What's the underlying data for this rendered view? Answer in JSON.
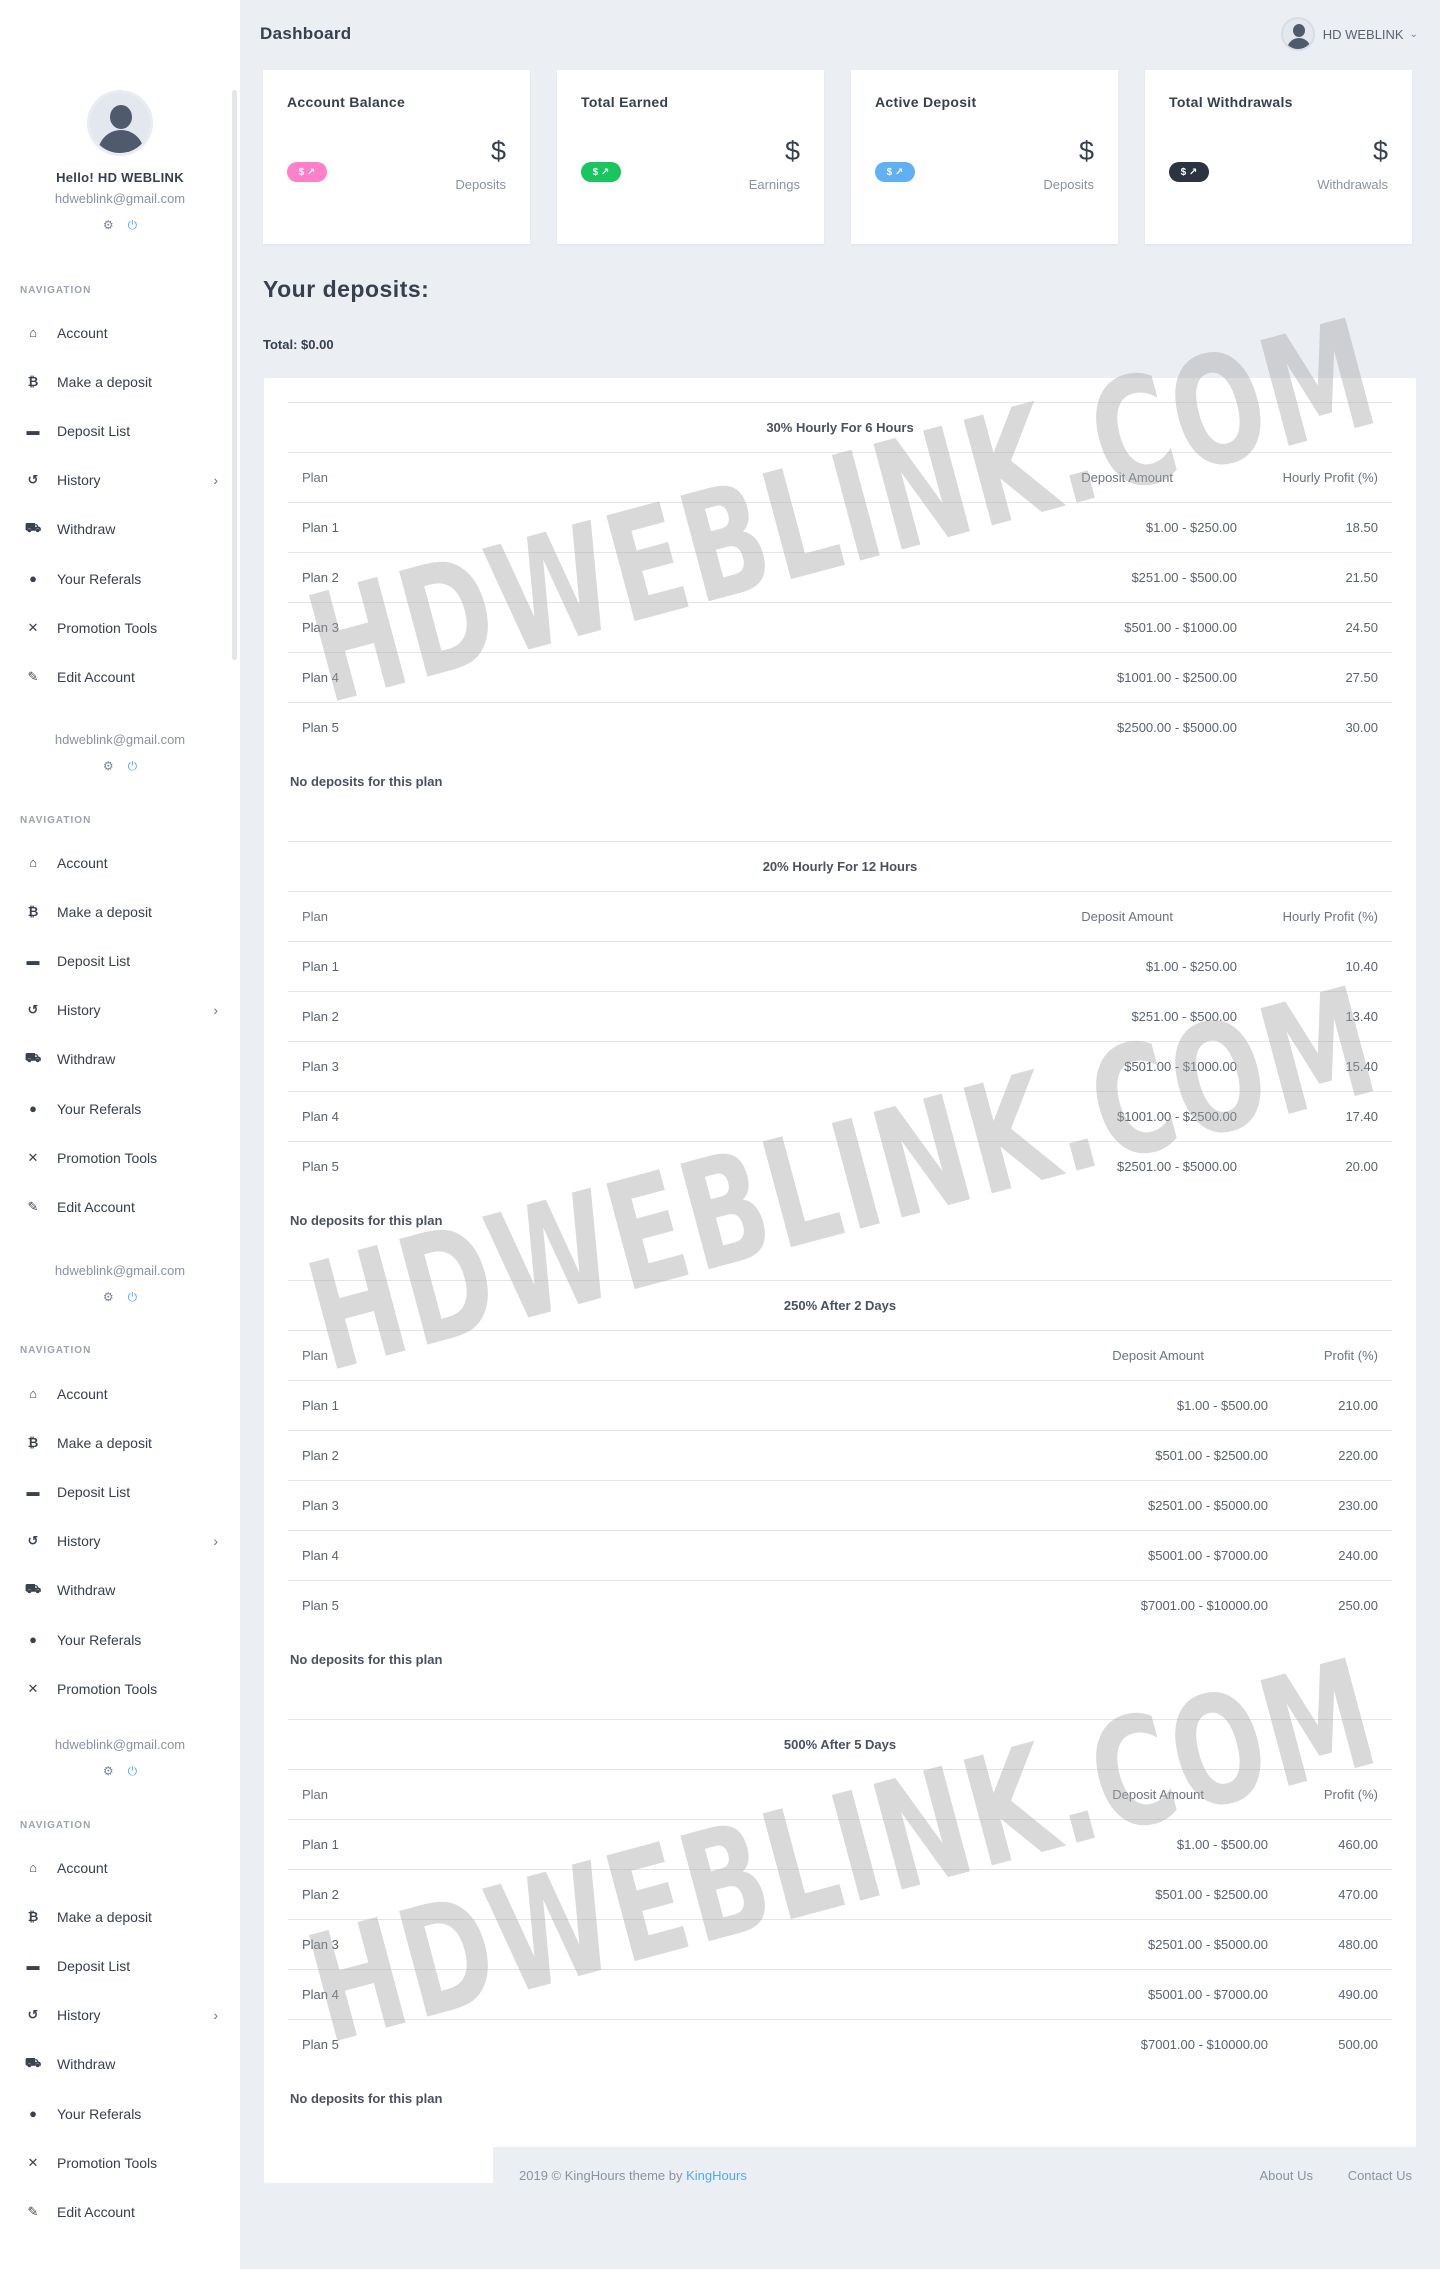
{
  "topbar": {
    "title": "Dashboard",
    "user_name": "HD WEBLINK"
  },
  "profile": {
    "greeting": "Hello! HD WEBLINK",
    "email": "hdweblink@gmail.com"
  },
  "nav": {
    "title": "NAVIGATION",
    "items": [
      "Account",
      "Make a deposit",
      "Deposit List",
      "History",
      "Withdraw",
      "Your Referals",
      "Promotion Tools",
      "Edit Account"
    ]
  },
  "stats": [
    {
      "title": "Account Balance",
      "value": "$",
      "sub": "Deposits",
      "pill": "$ ↗",
      "color": "#ff7fc8"
    },
    {
      "title": "Total Earned",
      "value": "$",
      "sub": "Earnings",
      "pill": "$ ↗",
      "color": "#17c65f"
    },
    {
      "title": "Active Deposit",
      "value": "$",
      "sub": "Deposits",
      "pill": "$ ↗",
      "color": "#5fb0f5"
    },
    {
      "title": "Total Withdrawals",
      "value": "$",
      "sub": "Withdrawals",
      "pill": "$ ↗",
      "color": "#2c3442"
    }
  ],
  "deposits": {
    "heading": "Your deposits:",
    "total": "Total: $0.00",
    "no_deposits": "No deposits for this plan"
  },
  "plans": [
    {
      "title": "30% Hourly For 6 Hours",
      "headers": [
        "Plan",
        "Deposit Amount",
        "Hourly Profit (%)"
      ],
      "rows": [
        [
          "Plan 1",
          "$1.00 - $250.00",
          "18.50"
        ],
        [
          "Plan 2",
          "$251.00 - $500.00",
          "21.50"
        ],
        [
          "Plan 3",
          "$501.00 - $1000.00",
          "24.50"
        ],
        [
          "Plan 4",
          "$1001.00 - $2500.00",
          "27.50"
        ],
        [
          "Plan 5",
          "$2500.00 - $5000.00",
          "30.00"
        ]
      ]
    },
    {
      "title": "20% Hourly For 12 Hours",
      "headers": [
        "Plan",
        "Deposit Amount",
        "Hourly Profit (%)"
      ],
      "rows": [
        [
          "Plan 1",
          "$1.00 - $250.00",
          "10.40"
        ],
        [
          "Plan 2",
          "$251.00 - $500.00",
          "13.40"
        ],
        [
          "Plan 3",
          "$501.00 - $1000.00",
          "15.40"
        ],
        [
          "Plan 4",
          "$1001.00 - $2500.00",
          "17.40"
        ],
        [
          "Plan 5",
          "$2501.00 - $5000.00",
          "20.00"
        ]
      ]
    },
    {
      "title": "250% After 2 Days",
      "headers": [
        "Plan",
        "Deposit Amount",
        "Profit (%)"
      ],
      "rows": [
        [
          "Plan 1",
          "$1.00 - $500.00",
          "210.00"
        ],
        [
          "Plan 2",
          "$501.00 - $2500.00",
          "220.00"
        ],
        [
          "Plan 3",
          "$2501.00 - $5000.00",
          "230.00"
        ],
        [
          "Plan 4",
          "$5001.00 - $7000.00",
          "240.00"
        ],
        [
          "Plan 5",
          "$7001.00 - $10000.00",
          "250.00"
        ]
      ]
    },
    {
      "title": "500% After 5 Days",
      "headers": [
        "Plan",
        "Deposit Amount",
        "Profit (%)"
      ],
      "rows": [
        [
          "Plan 1",
          "$1.00 - $500.00",
          "460.00"
        ],
        [
          "Plan 2",
          "$501.00 - $2500.00",
          "470.00"
        ],
        [
          "Plan 3",
          "$2501.00 - $5000.00",
          "480.00"
        ],
        [
          "Plan 4",
          "$5001.00 - $7000.00",
          "490.00"
        ],
        [
          "Plan 5",
          "$7001.00 - $10000.00",
          "500.00"
        ]
      ]
    }
  ],
  "footer": {
    "copyright": "2019 © KingHours theme by ",
    "brand": "KingHours",
    "about": "About Us",
    "contact": "Contact Us"
  },
  "watermark": "HDWEBLINK.COM"
}
